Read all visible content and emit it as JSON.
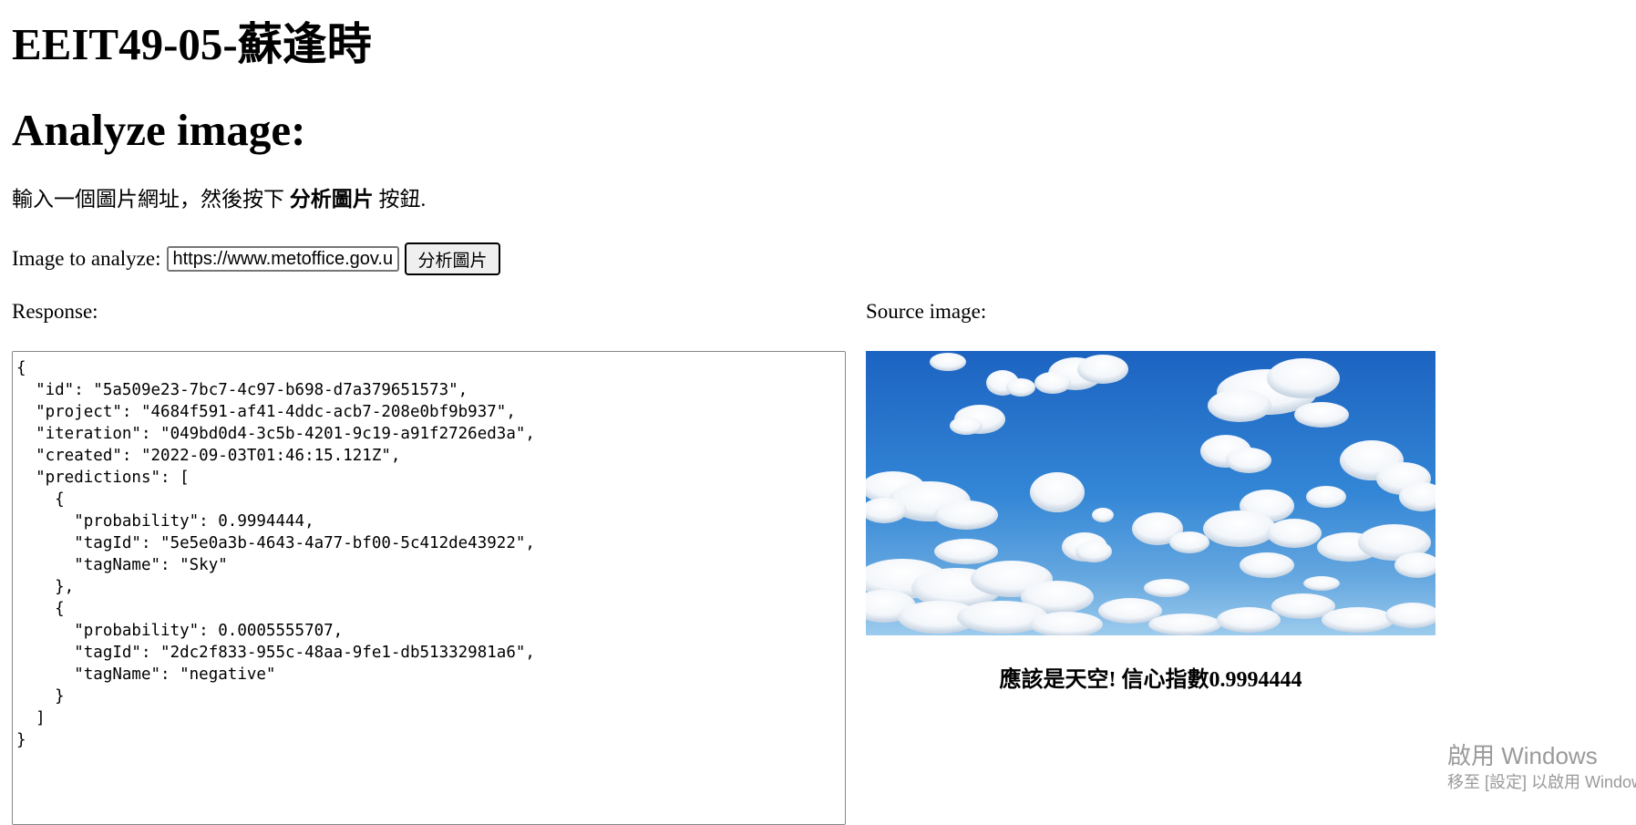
{
  "header": {
    "title": "EEIT49-05-蘇逢時",
    "subtitle": "Analyze image:"
  },
  "instructions": {
    "prefix": "輸入一個圖片網址，然後按下",
    "button_name": "分析圖片",
    "suffix": "按鈕."
  },
  "analyze": {
    "label": "Image to analyze:",
    "url_value": "https://www.metoffice.gov.uk/",
    "button_label": "分析圖片"
  },
  "response": {
    "label": "Response:",
    "json_text": "{\n  \"id\": \"5a509e23-7bc7-4c97-b698-d7a379651573\",\n  \"project\": \"4684f591-af41-4ddc-acb7-208e0bf9b937\",\n  \"iteration\": \"049bd0d4-3c5b-4201-9c19-a91f2726ed3a\",\n  \"created\": \"2022-09-03T01:46:15.121Z\",\n  \"predictions\": [\n    {\n      \"probability\": 0.9994444,\n      \"tagId\": \"5e5e0a3b-4643-4a77-bf00-5c412de43922\",\n      \"tagName\": \"Sky\"\n    },\n    {\n      \"probability\": 0.0005555707,\n      \"tagId\": \"2dc2f833-955c-48aa-9fe1-db51332981a6\",\n      \"tagName\": \"negative\"\n    }\n  ]\n}"
  },
  "source": {
    "label": "Source image:",
    "result_text": "應該是天空! 信心指數0.9994444"
  },
  "watermark": {
    "line1": "啟用 Windows",
    "line2": "移至 [設定] 以啟用 Windows。"
  },
  "colors": {
    "sky_top": "#1e68c5",
    "sky_bottom": "#8bc2ea",
    "cloud": "#ffffff"
  }
}
